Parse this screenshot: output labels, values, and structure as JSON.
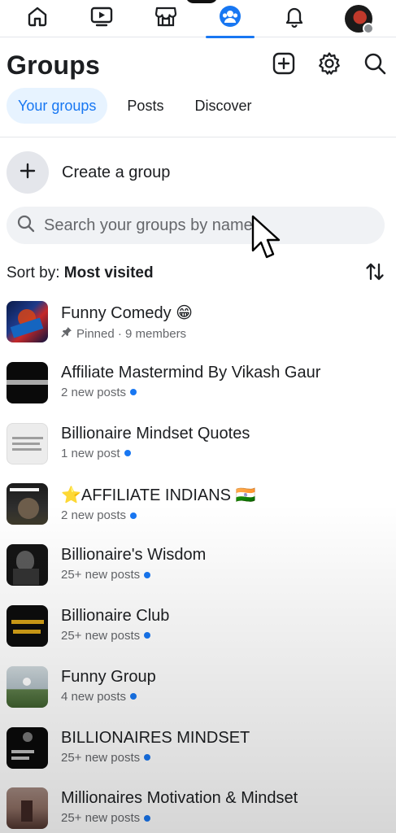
{
  "nav": {
    "items": [
      {
        "name": "home",
        "icon": "home-icon"
      },
      {
        "name": "watch",
        "icon": "video-icon"
      },
      {
        "name": "marketplace",
        "icon": "store-icon"
      },
      {
        "name": "groups",
        "icon": "groups-icon",
        "active": true
      },
      {
        "name": "notifications",
        "icon": "bell-icon"
      },
      {
        "name": "profile",
        "icon": "avatar"
      }
    ],
    "accent": "#1877f2"
  },
  "header": {
    "title": "Groups",
    "actions": [
      "add-icon",
      "gear-icon",
      "search-icon"
    ]
  },
  "tabs": [
    {
      "label": "Your groups",
      "active": true
    },
    {
      "label": "Posts",
      "active": false
    },
    {
      "label": "Discover",
      "active": false
    }
  ],
  "create": {
    "label": "Create a group"
  },
  "search": {
    "placeholder": "Search your groups by name"
  },
  "sort": {
    "prefix": "Sort by:",
    "value": "Most visited"
  },
  "groups": [
    {
      "name": "Funny Comedy 😁",
      "meta": "Pinned · 9 members",
      "pinned": true,
      "new_dot": false
    },
    {
      "name": "Affiliate Mastermind By Vikash Gaur",
      "meta": "2 new posts",
      "new_dot": true
    },
    {
      "name": "Billionaire Mindset Quotes",
      "meta": "1 new post",
      "new_dot": true
    },
    {
      "name": "⭐AFFILIATE INDIANS 🇮🇳",
      "meta": "2 new posts",
      "new_dot": true
    },
    {
      "name": "Billionaire's Wisdom",
      "meta": "25+ new posts",
      "new_dot": true
    },
    {
      "name": "Billionaire Club",
      "meta": "25+ new posts",
      "new_dot": true
    },
    {
      "name": "Funny Group",
      "meta": "4 new posts",
      "new_dot": true
    },
    {
      "name": "BILLIONAIRES MINDSET",
      "meta": "25+ new posts",
      "new_dot": true
    },
    {
      "name": "Millionaires Motivation & Mindset",
      "meta": "25+ new posts",
      "new_dot": true
    }
  ]
}
